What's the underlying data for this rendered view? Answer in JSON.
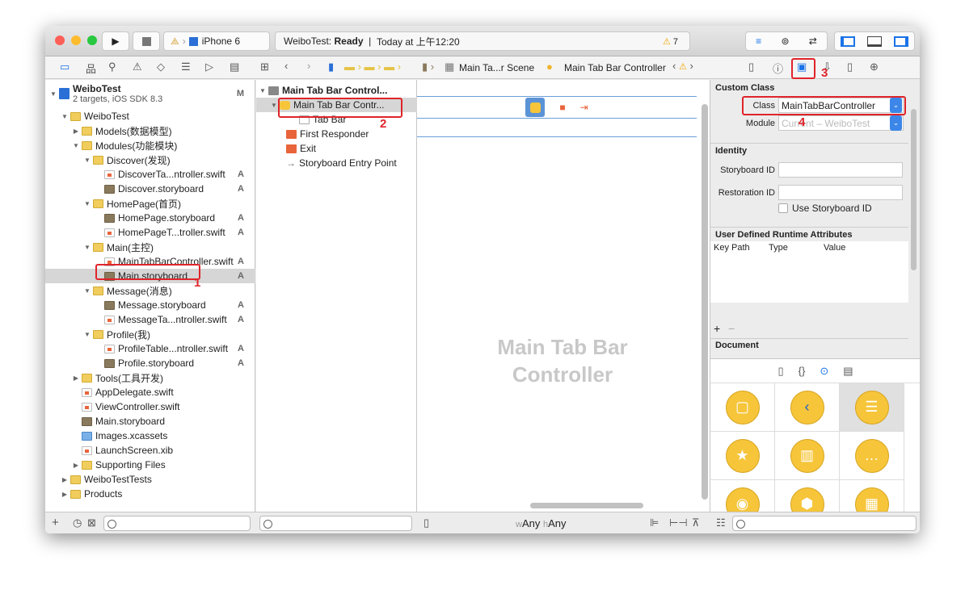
{
  "toolbar": {
    "scheme": "iPhone 6",
    "status_project": "WeiboTest:",
    "status_state": "Ready",
    "status_time": "Today at 上午12:20",
    "warnings": "7"
  },
  "jumpbar": {
    "scene": "Main Ta...r Scene",
    "controller": "Main Tab Bar Controller"
  },
  "navigator": {
    "project": "WeiboTest",
    "project_sub": "2 targets, iOS SDK 8.3",
    "project_badge": "M",
    "items": [
      {
        "label": "WeiboTest",
        "level": 1,
        "type": "folder",
        "open": true
      },
      {
        "label": "Models(数据模型)",
        "level": 2,
        "type": "folder",
        "open": false
      },
      {
        "label": "Modules(功能模块)",
        "level": 2,
        "type": "folder",
        "open": true
      },
      {
        "label": "Discover(发现)",
        "level": 3,
        "type": "folder",
        "open": true
      },
      {
        "label": "DiscoverTa...ntroller.swift",
        "level": 4,
        "type": "swift",
        "badge": "A"
      },
      {
        "label": "Discover.storyboard",
        "level": 4,
        "type": "sb",
        "badge": "A"
      },
      {
        "label": "HomePage(首页)",
        "level": 3,
        "type": "folder",
        "open": true
      },
      {
        "label": "HomePage.storyboard",
        "level": 4,
        "type": "sb",
        "badge": "A"
      },
      {
        "label": "HomePageT...troller.swift",
        "level": 4,
        "type": "swift",
        "badge": "A"
      },
      {
        "label": "Main(主控)",
        "level": 3,
        "type": "folder",
        "open": true
      },
      {
        "label": "MainTabBarController.swift",
        "level": 4,
        "type": "swift",
        "badge": "A"
      },
      {
        "label": "Main.storyboard",
        "level": 4,
        "type": "sb",
        "badge": "A",
        "selected": true
      },
      {
        "label": "Message(消息)",
        "level": 3,
        "type": "folder",
        "open": true
      },
      {
        "label": "Message.storyboard",
        "level": 4,
        "type": "sb",
        "badge": "A"
      },
      {
        "label": "MessageTa...ntroller.swift",
        "level": 4,
        "type": "swift",
        "badge": "A"
      },
      {
        "label": "Profile(我)",
        "level": 3,
        "type": "folder",
        "open": true
      },
      {
        "label": "ProfileTable...ntroller.swift",
        "level": 4,
        "type": "swift",
        "badge": "A"
      },
      {
        "label": "Profile.storyboard",
        "level": 4,
        "type": "sb",
        "badge": "A"
      },
      {
        "label": "Tools(工具开发)",
        "level": 2,
        "type": "folder",
        "open": false
      },
      {
        "label": "AppDelegate.swift",
        "level": 2,
        "type": "swift"
      },
      {
        "label": "ViewController.swift",
        "level": 2,
        "type": "swift"
      },
      {
        "label": "Main.storyboard",
        "level": 2,
        "type": "sb"
      },
      {
        "label": "Images.xcassets",
        "level": 2,
        "type": "assets"
      },
      {
        "label": "LaunchScreen.xib",
        "level": 2,
        "type": "swift"
      },
      {
        "label": "Supporting Files",
        "level": 2,
        "type": "folder",
        "open": false
      },
      {
        "label": "WeiboTestTests",
        "level": 1,
        "type": "folder",
        "open": false
      },
      {
        "label": "Products",
        "level": 1,
        "type": "folder",
        "open": false
      }
    ]
  },
  "outline": {
    "scene": "Main Tab Bar Control...",
    "controller": "Main Tab Bar Contr...",
    "tabbar": "Tab Bar",
    "first_responder": "First Responder",
    "exit": "Exit",
    "entry": "Storyboard Entry Point"
  },
  "canvas": {
    "title": "Main Tab Bar Controller",
    "size_w": "w",
    "size_w_val": "Any",
    "size_h": "h",
    "size_h_val": "Any"
  },
  "inspector": {
    "custom_class": "Custom Class",
    "class_label": "Class",
    "class_value": "MainTabBarController",
    "module_label": "Module",
    "module_placeholder": "Current – WeiboTest",
    "identity": "Identity",
    "storyboard_id": "Storyboard ID",
    "restoration_id": "Restoration ID",
    "use_storyboard_id": "Use Storyboard ID",
    "runtime_attrs": "User Defined Runtime Attributes",
    "col_keypath": "Key Path",
    "col_type": "Type",
    "col_value": "Value",
    "document": "Document"
  },
  "annotations": [
    "1",
    "2",
    "3",
    "4"
  ],
  "colors": {
    "highlight": "#e0242a",
    "accent": "#1a73e8",
    "icon_yellow": "#f6c53a"
  }
}
